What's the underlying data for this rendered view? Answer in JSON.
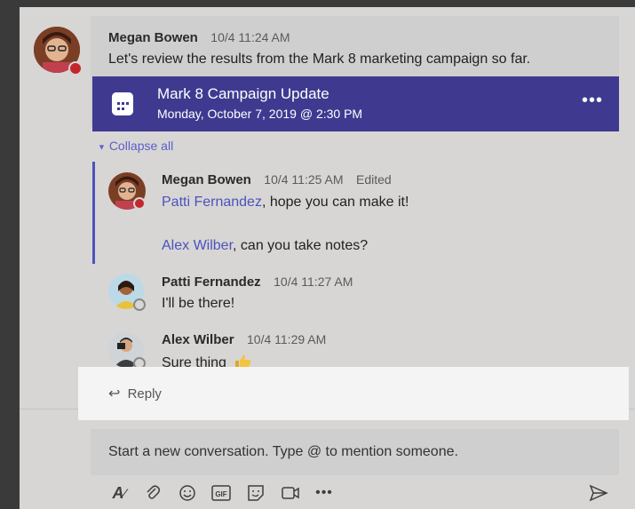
{
  "post": {
    "author": "Megan Bowen",
    "time": "10/4 11:24 AM",
    "text": "Let's review the results from the Mark 8 marketing campaign so far."
  },
  "event": {
    "title": "Mark 8 Campaign Update",
    "date": "Monday, October 7, 2019 @ 2:30 PM",
    "more_icon": "more-horizontal-icon"
  },
  "collapse_label": "Collapse all",
  "replies": [
    {
      "author": "Megan Bowen",
      "time": "10/4 11:25 AM",
      "edited": "Edited",
      "line1_mention": "Patti Fernandez",
      "line1_text": ", hope you can make it!",
      "line2_mention": "Alex Wilber",
      "line2_text": ", can you take notes?"
    },
    {
      "author": "Patti Fernandez",
      "time": "10/4 11:27 AM",
      "text": "I'll be there!"
    },
    {
      "author": "Alex Wilber",
      "time": "10/4 11:29 AM",
      "text": "Sure thing"
    }
  ],
  "reply_label": "Reply",
  "compose_placeholder": "Start a new conversation. Type @ to mention someone.",
  "toolbar_icons": [
    "format-icon",
    "attach-icon",
    "emoji-icon",
    "gif-icon",
    "sticker-icon",
    "meet-now-icon",
    "more-icon",
    "send-icon"
  ],
  "colors": {
    "accent": "#3f3a90",
    "mention": "#4b53bc",
    "busy": "#c4262e"
  }
}
